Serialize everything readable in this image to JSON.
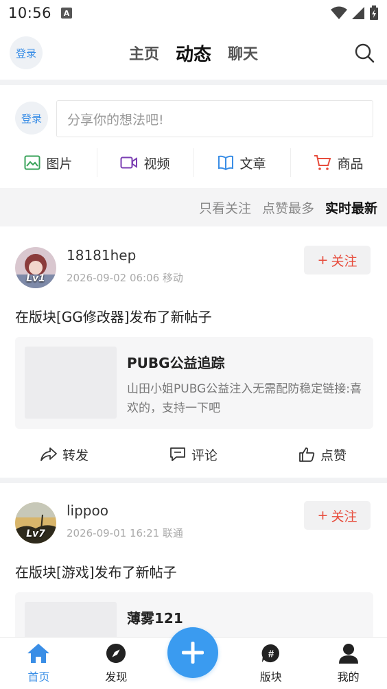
{
  "status_bar": {
    "time": "10:56",
    "a_badge": "A"
  },
  "top_nav": {
    "login_label": "登录",
    "tabs": [
      {
        "label": "主页",
        "active": false
      },
      {
        "label": "动态",
        "active": true
      },
      {
        "label": "聊天",
        "active": false
      }
    ]
  },
  "composer": {
    "login_label": "登录",
    "placeholder": "分享你的想法吧!",
    "media": [
      {
        "label": "图片",
        "icon": "image-icon",
        "color": "#3aa35a"
      },
      {
        "label": "视频",
        "icon": "video-icon",
        "color": "#7b3fb3"
      },
      {
        "label": "文章",
        "icon": "book-icon",
        "color": "#3a8ee6"
      },
      {
        "label": "商品",
        "icon": "cart-icon",
        "color": "#e74c3c"
      }
    ]
  },
  "filters": [
    {
      "label": "只看关注",
      "active": false
    },
    {
      "label": "点赞最多",
      "active": false
    },
    {
      "label": "实时最新",
      "active": true
    }
  ],
  "posts": [
    {
      "username": "18181hep",
      "level": "Lv1",
      "meta": "2026-09-02 06:06 移动",
      "follow_label": "关注",
      "action_text": "在版块[GG修改器]发布了新帖子",
      "card_title": "PUBG公益追踪",
      "card_desc": "山田小姐PUBG公益注入无需配防稳定链接:喜欢的，支持一下吧",
      "actions": [
        "转发",
        "评论",
        "点赞"
      ]
    },
    {
      "username": "lippoo",
      "level": "Lv7",
      "meta": "2026-09-01 16:21 联通",
      "follow_label": "关注",
      "action_text": "在版块[游戏]发布了新帖子",
      "card_title": "薄雾121"
    }
  ],
  "bottom_nav": [
    {
      "label": "首页",
      "icon": "home-icon",
      "active": true
    },
    {
      "label": "发现",
      "icon": "compass-icon",
      "active": false
    },
    {
      "label": "版块",
      "icon": "hashtag-icon",
      "active": false
    },
    {
      "label": "我的",
      "icon": "user-icon",
      "active": false
    }
  ],
  "colors": {
    "accent": "#3a8ee6",
    "follow": "#e74c3c",
    "fab": "#3a9bf0"
  }
}
